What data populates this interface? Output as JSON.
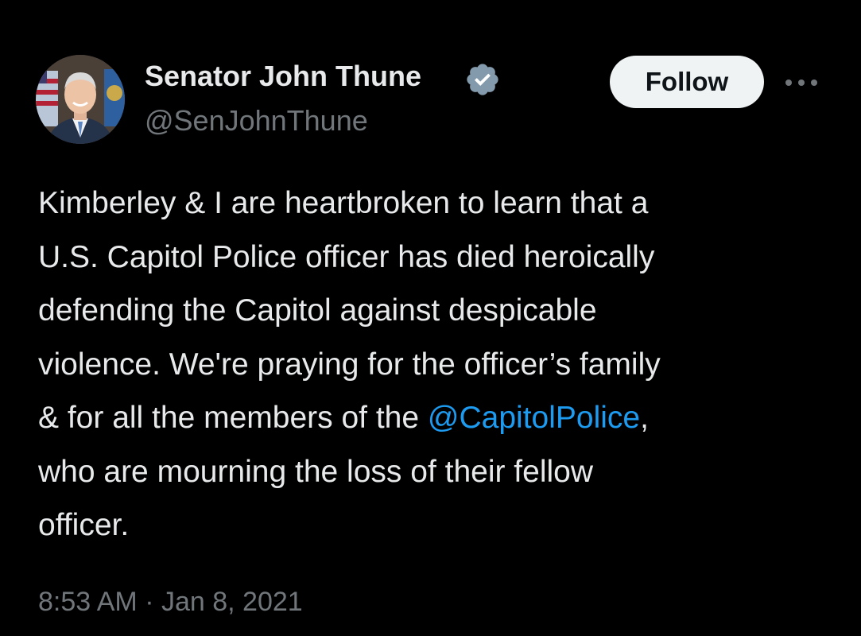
{
  "author": {
    "display_name": "Senator John Thune",
    "handle": "@SenJohnThune",
    "verified": true,
    "avatar_icon": "profile-photo"
  },
  "actions": {
    "follow_label": "Follow",
    "more_icon": "ellipsis-icon"
  },
  "tweet": {
    "lines": [
      "Kimberley & I are heartbroken to learn that a",
      "U.S. Capitol Police officer has died heroically",
      "defending the Capitol against despicable",
      "violence. We're praying for the officer’s family"
    ],
    "line5_before": "& for all the members of the ",
    "mention": "@CapitolPolice",
    "line5_after": ",",
    "line6": "who are mourning the loss of their fellow",
    "line7": "officer."
  },
  "meta": {
    "time": "8:53 AM",
    "separator": "·",
    "date": "Jan 8, 2021"
  },
  "colors": {
    "background": "#000000",
    "text": "#e7e9ea",
    "secondary": "#71767b",
    "link": "#1d9bf0",
    "verified_badge": "#829aab"
  }
}
